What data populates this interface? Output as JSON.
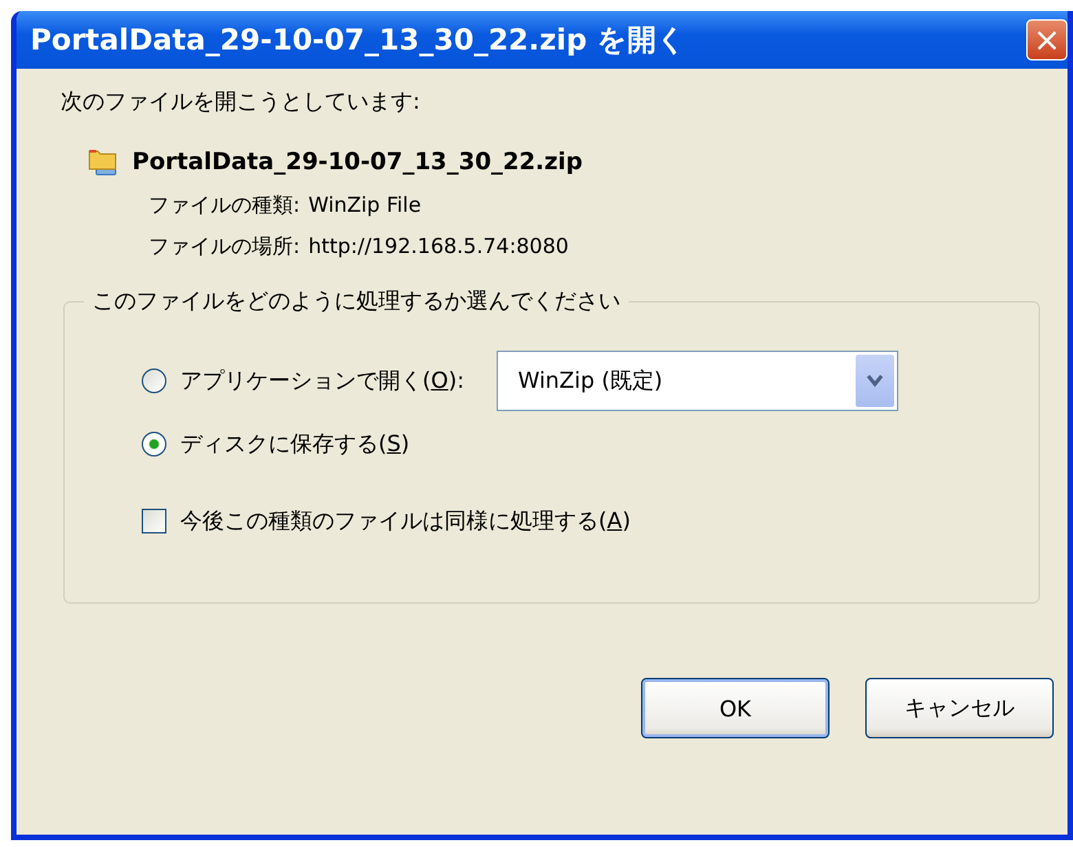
{
  "window": {
    "title": "PortalData_29-10-07_13_30_22.zip を開く",
    "close": "×"
  },
  "intro": "次のファイルを開こうとしています:",
  "file": {
    "name": "PortalData_29-10-07_13_30_22.zip",
    "type_label": "ファイルの種類:",
    "type_value": "WinZip File",
    "location_label": "ファイルの場所:",
    "location_value": "http://192.168.5.74:8080"
  },
  "group": {
    "legend": "このファイルをどのように処理するか選んでください",
    "options": [
      {
        "kind": "radio",
        "before": "アプリケーションで開く(",
        "key": "O",
        "after": "):",
        "selected": false,
        "dropdown": {
          "value": "WinZip (既定)"
        }
      },
      {
        "kind": "radio",
        "before": "ディスクに保存する(",
        "key": "S",
        "after": ")",
        "selected": true
      },
      {
        "kind": "checkbox",
        "before": "今後この種類のファイルは同様に処理する(",
        "key": "A",
        "after": ")",
        "checked": false
      }
    ]
  },
  "buttons": [
    {
      "label": "OK",
      "default": true
    },
    {
      "label": "キャンセル",
      "default": false
    }
  ]
}
